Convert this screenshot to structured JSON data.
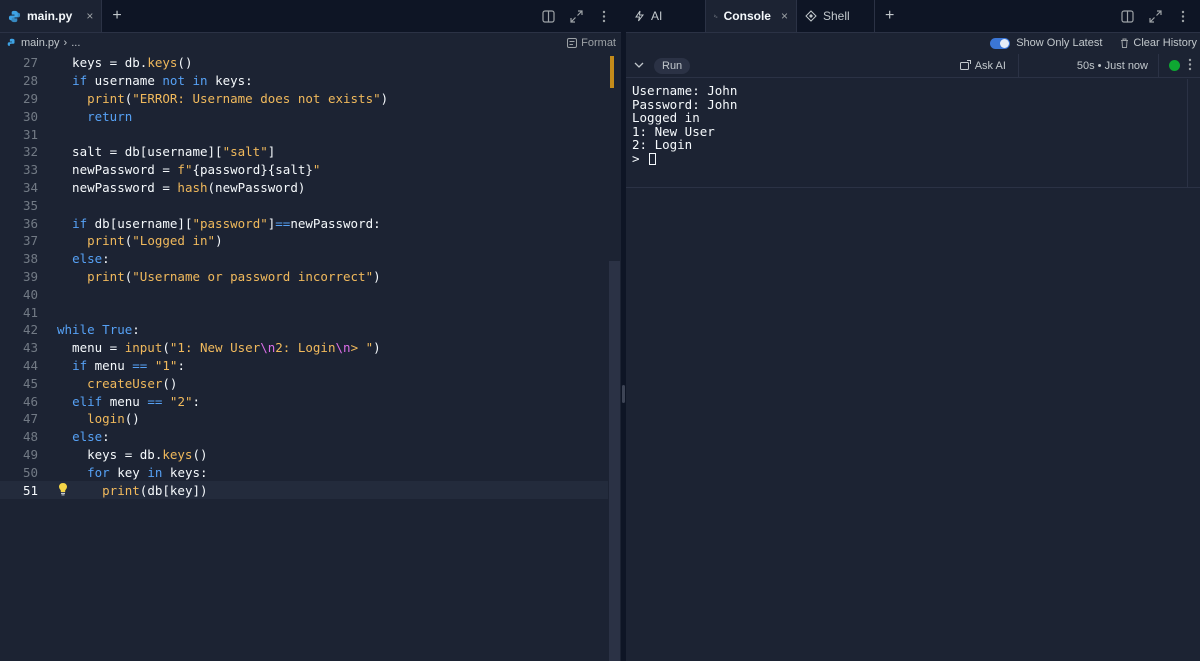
{
  "editor": {
    "tab_label": "main.py",
    "close_glyph": "×",
    "add_glyph": "+",
    "breadcrumb": {
      "file": "main.py",
      "sep": "›",
      "more": "..."
    },
    "format_label": "Format",
    "lines": [
      {
        "n": "27",
        "html": "  keys = db.<span class='bi'>keys</span>()"
      },
      {
        "n": "28",
        "html": "  <span class='kw'>if</span> username <span class='kw'>not in</span> keys:"
      },
      {
        "n": "29",
        "html": "    <span class='bi'>print</span>(<span class='st'>\"ERROR: Username does not exists\"</span>)"
      },
      {
        "n": "30",
        "html": "    <span class='kw'>return</span>"
      },
      {
        "n": "31",
        "html": ""
      },
      {
        "n": "32",
        "html": "  salt = db[username][<span class='st'>\"salt\"</span>]"
      },
      {
        "n": "33",
        "html": "  newPassword = <span class='st'>f\"</span>{password}{salt}<span class='st'>\"</span>"
      },
      {
        "n": "34",
        "html": "  newPassword = <span class='bi'>hash</span>(newPassword)"
      },
      {
        "n": "35",
        "html": ""
      },
      {
        "n": "36",
        "html": "  <span class='kw'>if</span> db[username][<span class='st'>\"password\"</span>]<span class='kw'>==</span>newPassword:"
      },
      {
        "n": "37",
        "html": "    <span class='bi'>print</span>(<span class='st'>\"Logged in\"</span>)"
      },
      {
        "n": "38",
        "html": "  <span class='kw'>else</span>:"
      },
      {
        "n": "39",
        "html": "    <span class='bi'>print</span>(<span class='st'>\"Username or password incorrect\"</span>)"
      },
      {
        "n": "40",
        "html": ""
      },
      {
        "n": "41",
        "html": ""
      },
      {
        "n": "42",
        "html": "<span class='kw'>while</span> <span class='kw'>True</span>:"
      },
      {
        "n": "43",
        "html": "  menu = <span class='bi'>input</span>(<span class='st'>\"1: New User</span><span class='esc'>\\n</span><span class='st'>2: Login</span><span class='esc'>\\n</span><span class='st'>&gt; \"</span>)"
      },
      {
        "n": "44",
        "html": "  <span class='kw'>if</span> menu <span class='kw'>==</span> <span class='st'>\"1\"</span>:"
      },
      {
        "n": "45",
        "html": "    <span class='bi'>createUser</span>()"
      },
      {
        "n": "46",
        "html": "  <span class='kw'>elif</span> menu <span class='kw'>==</span> <span class='st'>\"2\"</span>:"
      },
      {
        "n": "47",
        "html": "    <span class='bi'>login</span>()"
      },
      {
        "n": "48",
        "html": "  <span class='kw'>else</span>:"
      },
      {
        "n": "49",
        "html": "    keys = db.<span class='bi'>keys</span>()"
      },
      {
        "n": "50",
        "html": "    <span class='kw'>for</span> key <span class='kw'>in</span> keys:"
      },
      {
        "n": "51",
        "html": "      <span class='bi'>print</span>(db[key])",
        "current": true
      }
    ]
  },
  "tools": {
    "tabs": [
      {
        "label": "AI",
        "icon": "ai-icon"
      },
      {
        "label": "Console",
        "icon": "console-icon",
        "active": true
      },
      {
        "label": "Shell",
        "icon": "shell-icon"
      }
    ],
    "close_glyph": "×",
    "add_glyph": "+"
  },
  "console": {
    "show_only_latest": "Show Only Latest",
    "clear_history": "Clear History",
    "run_label": "Run",
    "ask_ai": "Ask AI",
    "timing": "50s • Just now",
    "output": "Username: John\nPassword: John\nLogged in\n1: New User\n2: Login\n> "
  },
  "colors": {
    "background": "#1c2333",
    "keyword": "#56a1f5",
    "string": "#f0b95c",
    "escape": "#db6ee8",
    "status_ok": "#0ea832",
    "toggle_on": "#3b76d6"
  }
}
